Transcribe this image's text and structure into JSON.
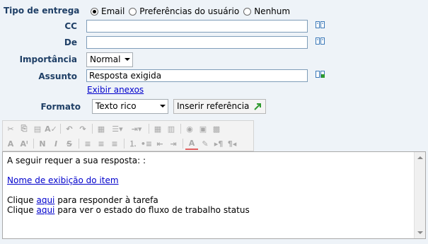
{
  "form": {
    "delivery_type_label": "Tipo de entrega",
    "delivery_options": [
      "Email",
      "Preferências do usuário",
      "Nenhum"
    ],
    "delivery_selected": "Email",
    "cc_label": "CC",
    "cc_value": "",
    "from_label": "De",
    "from_value": "",
    "importance_label": "Importância",
    "importance_value": "Normal",
    "subject_label": "Assunto",
    "subject_value": "Resposta exigida",
    "show_attachments": "Exibir anexos",
    "format_label": "Formato",
    "format_value": "Texto rico",
    "insert_reference": "Inserir referência"
  },
  "editor": {
    "line1": "A seguir requer a sua resposta: :",
    "item_link": "Nome de exibição do item",
    "line3_prefix": "Clique ",
    "line3_link": "aqui",
    "line3_suffix": " para responder à tarefa",
    "line4_prefix": "Clique ",
    "line4_link": "aqui",
    "line4_suffix": " para ver o estado do fluxo de trabalho status"
  },
  "toolbar": {
    "row1": [
      "cut-icon",
      "copy-icon",
      "paste-icon",
      "spellcheck-icon",
      "undo-icon",
      "redo-icon",
      "table-icon",
      "list-style-icon",
      "indent-style-icon",
      "grid-icon",
      "columns-icon",
      "image-icon",
      "media-icon",
      "special-char-icon"
    ],
    "row2": [
      "font-size-icon",
      "font-grow-icon",
      "bold-icon",
      "italic-icon",
      "strike-icon",
      "align-left-icon",
      "align-center-icon",
      "align-right-icon",
      "ordered-list-icon",
      "unordered-list-icon",
      "outdent-icon",
      "indent-icon",
      "font-color-icon",
      "highlight-icon",
      "ltr-icon",
      "rtl-icon"
    ]
  },
  "colors": {
    "label": "#1f3f66",
    "link": "#0000cc",
    "background": "#eef3f8"
  }
}
